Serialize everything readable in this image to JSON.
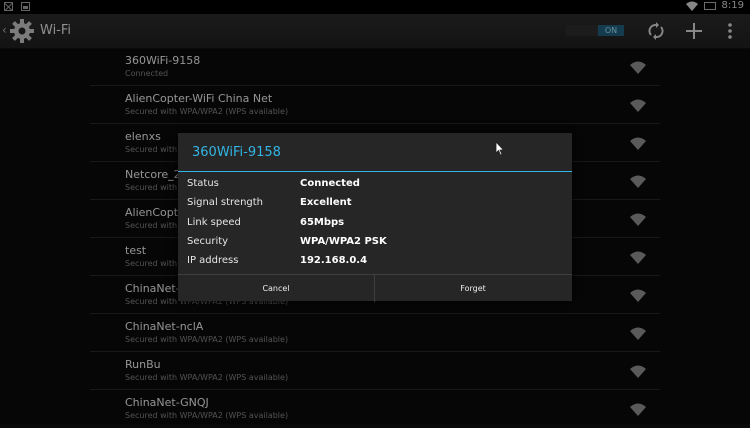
{
  "status_bar": {
    "time": "8:19"
  },
  "action_bar": {
    "title": "Wi-Fi",
    "toggle_label": "ON"
  },
  "networks": [
    {
      "ssid": "360WiFi-9158",
      "status": "Connected"
    },
    {
      "ssid": "AlienCopter-WiFi China Net",
      "status": "Secured with WPA/WPA2 (WPS available)"
    },
    {
      "ssid": "elenxs",
      "status": "Secured with WPA/WPA2 (WPS available)"
    },
    {
      "ssid": "Netcore_2_",
      "status": "Secured with WPA/WPA2 (WPS available)"
    },
    {
      "ssid": "AlienCopter",
      "status": "Secured with WPA/WPA2 (WPS available)"
    },
    {
      "ssid": "test",
      "status": "Secured with WPA/WPA2 (WPS available)"
    },
    {
      "ssid": "ChinaNet-q",
      "status": "Secured with WPA/WPA2 (WPS available)"
    },
    {
      "ssid": "ChinaNet-nclA",
      "status": "Secured with WPA/WPA2 (WPS available)"
    },
    {
      "ssid": "RunBu",
      "status": "Secured with WPA/WPA2 (WPS available)"
    },
    {
      "ssid": "ChinaNet-GNQJ",
      "status": "Secured with WPA/WPA2 (WPS available)"
    }
  ],
  "dialog": {
    "title": "360WiFi-9158",
    "rows": [
      {
        "label": "Status",
        "value": "Connected"
      },
      {
        "label": "Signal strength",
        "value": "Excellent"
      },
      {
        "label": "Link speed",
        "value": "65Mbps"
      },
      {
        "label": "Security",
        "value": "WPA/WPA2 PSK"
      },
      {
        "label": "IP address",
        "value": "192.168.0.4"
      }
    ],
    "cancel_label": "Cancel",
    "forget_label": "Forget"
  },
  "colors": {
    "accent": "#33b5e5",
    "background": "#0a0a0a",
    "dialog": "#262626"
  }
}
